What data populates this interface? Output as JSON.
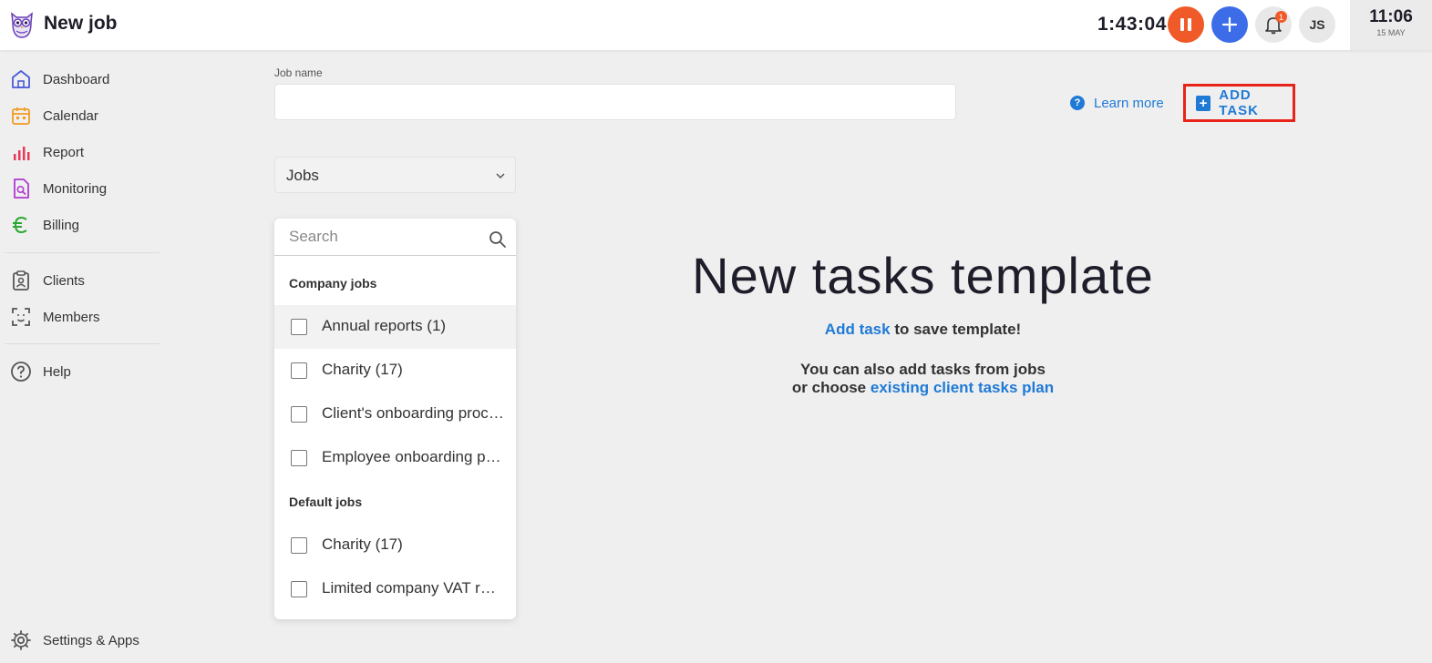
{
  "header": {
    "title": "New job",
    "timer": "1:43:04",
    "notification_count": "1",
    "avatar_initials": "JS",
    "clock_time": "11:06",
    "clock_date": "15 MAY",
    "colors": {
      "pause": "#f05a28",
      "add": "#3d6ce8"
    }
  },
  "sidebar": {
    "items": [
      {
        "label": "Dashboard",
        "icon": "house-icon"
      },
      {
        "label": "Calendar",
        "icon": "calendar-icon"
      },
      {
        "label": "Report",
        "icon": "bar-chart-icon"
      },
      {
        "label": "Monitoring",
        "icon": "document-search-icon"
      },
      {
        "label": "Billing",
        "icon": "euro-icon"
      },
      {
        "label": "Clients",
        "icon": "clipboard-user-icon"
      },
      {
        "label": "Members",
        "icon": "face-scan-icon"
      },
      {
        "label": "Help",
        "icon": "question-circle-icon"
      }
    ],
    "settings_label": "Settings & Apps"
  },
  "form": {
    "job_name_label": "Job name",
    "job_name_value": "",
    "learn_more": "Learn more",
    "add_task": "ADD TASK",
    "jobs_select": "Jobs",
    "search_placeholder": "Search"
  },
  "dropdown": {
    "company_title": "Company jobs",
    "company_jobs": [
      "Annual reports (1)",
      "Charity (17)",
      "Client's onboarding process",
      "Employee onboarding process"
    ],
    "default_title": "Default jobs",
    "default_jobs": [
      "Charity (17)",
      "Limited company VAT return"
    ]
  },
  "main": {
    "title": "New tasks template",
    "add_task_link": "Add task",
    "add_task_rest": " to save template!",
    "line2a": "You can also add tasks from jobs",
    "line2b": "or choose ",
    "plan_link": "existing client tasks plan"
  },
  "colors": {
    "accent": "#1f7ad6",
    "highlight": "#e8231a"
  }
}
